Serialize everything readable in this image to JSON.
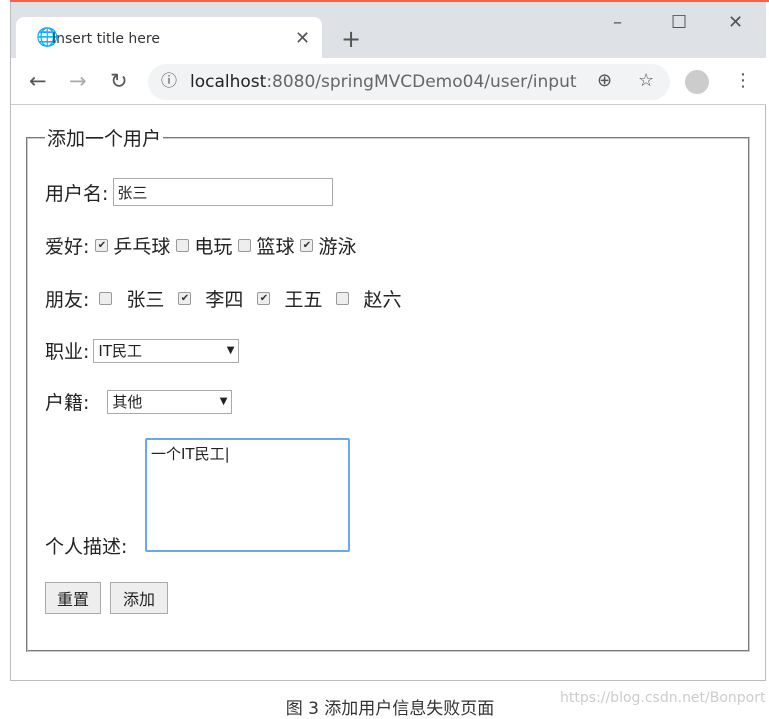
{
  "browser": {
    "tab_title": "Insert title here",
    "url_host": "localhost",
    "url_rest": ":8080/springMVCDemo04/user/input"
  },
  "form": {
    "legend": "添加一个用户",
    "username_label": "用户名:",
    "username_value": "张三",
    "hobby_label": "爱好:",
    "hobbies": [
      {
        "label": "乒乓球",
        "checked": true
      },
      {
        "label": "电玩",
        "checked": false
      },
      {
        "label": "篮球",
        "checked": false
      },
      {
        "label": "游泳",
        "checked": true
      }
    ],
    "friend_label": "朋友:",
    "friends": [
      {
        "label": "张三",
        "checked": false
      },
      {
        "label": "李四",
        "checked": true
      },
      {
        "label": "王五",
        "checked": true
      },
      {
        "label": "赵六",
        "checked": false
      }
    ],
    "job_label": "职业:",
    "job_value": "IT民工",
    "hukou_label": "户籍:",
    "hukou_value": "其他",
    "desc_label": "个人描述:",
    "desc_value": "一个IT民工",
    "reset_label": "重置",
    "submit_label": "添加"
  },
  "caption": "图 3  添加用户信息失败页面",
  "watermark": "https://blog.csdn.net/Bonport"
}
